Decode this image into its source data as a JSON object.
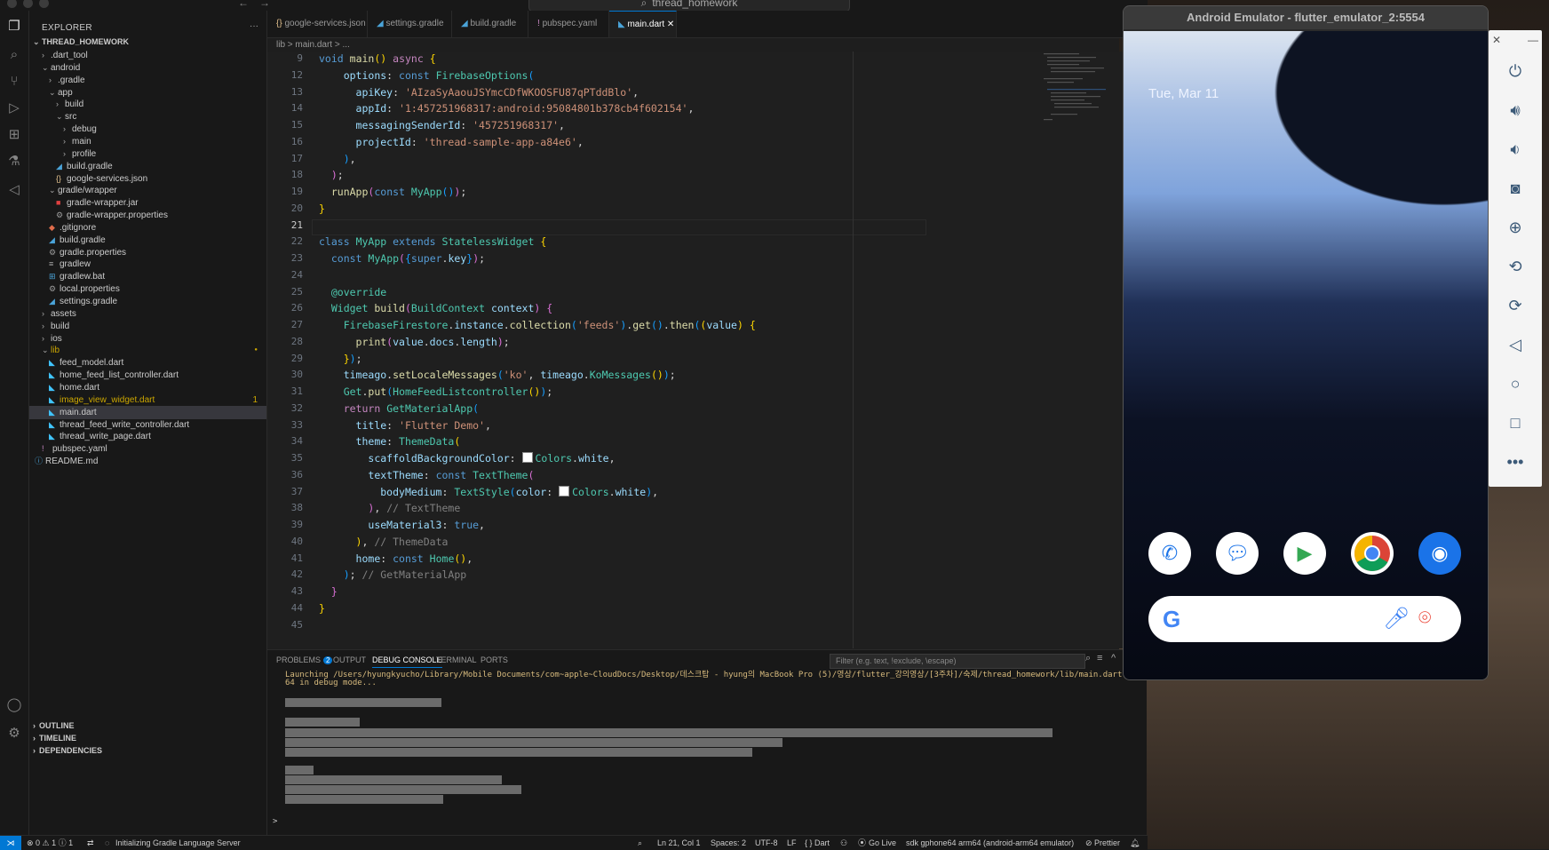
{
  "window": {
    "search_title": "thread_homework"
  },
  "explorer": {
    "title": "EXPLORER",
    "more": "···",
    "root": "THREAD_HOMEWORK",
    "items": [
      {
        "label": ".dart_tool",
        "depth": 1,
        "type": "folder",
        "open": false
      },
      {
        "label": "android",
        "depth": 1,
        "type": "folder",
        "open": true
      },
      {
        "label": ".gradle",
        "depth": 2,
        "type": "folder",
        "open": false
      },
      {
        "label": "app",
        "depth": 2,
        "type": "folder",
        "open": true
      },
      {
        "label": "build",
        "depth": 3,
        "type": "folder",
        "open": false
      },
      {
        "label": "src",
        "depth": 3,
        "type": "folder",
        "open": true
      },
      {
        "label": "debug",
        "depth": 4,
        "type": "folder",
        "open": false
      },
      {
        "label": "main",
        "depth": 4,
        "type": "folder",
        "open": false
      },
      {
        "label": "profile",
        "depth": 4,
        "type": "folder",
        "open": false
      },
      {
        "label": "build.gradle",
        "depth": 3,
        "type": "gradle"
      },
      {
        "label": "google-services.json",
        "depth": 3,
        "type": "json"
      },
      {
        "label": "gradle/wrapper",
        "depth": 2,
        "type": "folder",
        "open": true
      },
      {
        "label": "gradle-wrapper.jar",
        "depth": 3,
        "type": "jar"
      },
      {
        "label": "gradle-wrapper.properties",
        "depth": 3,
        "type": "gear"
      },
      {
        "label": ".gitignore",
        "depth": 2,
        "type": "git"
      },
      {
        "label": "build.gradle",
        "depth": 2,
        "type": "gradle"
      },
      {
        "label": "gradle.properties",
        "depth": 2,
        "type": "gear"
      },
      {
        "label": "gradlew",
        "depth": 2,
        "type": "text"
      },
      {
        "label": "gradlew.bat",
        "depth": 2,
        "type": "win"
      },
      {
        "label": "local.properties",
        "depth": 2,
        "type": "gear"
      },
      {
        "label": "settings.gradle",
        "depth": 2,
        "type": "gradle"
      },
      {
        "label": "assets",
        "depth": 1,
        "type": "folder",
        "open": false
      },
      {
        "label": "build",
        "depth": 1,
        "type": "folder",
        "open": false
      },
      {
        "label": "ios",
        "depth": 1,
        "type": "folder",
        "open": false
      },
      {
        "label": "lib",
        "depth": 1,
        "type": "folder",
        "open": true,
        "modified": true
      },
      {
        "label": "feed_model.dart",
        "depth": 2,
        "type": "dart"
      },
      {
        "label": "home_feed_list_controller.dart",
        "depth": 2,
        "type": "dart"
      },
      {
        "label": "home.dart",
        "depth": 2,
        "type": "dart"
      },
      {
        "label": "image_view_widget.dart",
        "depth": 2,
        "type": "dart",
        "warn": "1"
      },
      {
        "label": "main.dart",
        "depth": 2,
        "type": "dart",
        "selected": true
      },
      {
        "label": "thread_feed_write_controller.dart",
        "depth": 2,
        "type": "dart"
      },
      {
        "label": "thread_write_page.dart",
        "depth": 2,
        "type": "dart"
      },
      {
        "label": "pubspec.yaml",
        "depth": 1,
        "type": "yaml",
        "open": false
      },
      {
        "label": "README.md",
        "depth": 0,
        "type": "md"
      }
    ],
    "sections": [
      "OUTLINE",
      "TIMELINE",
      "DEPENDENCIES"
    ]
  },
  "tabs": [
    {
      "label": "google-services.json",
      "icon": "{}"
    },
    {
      "label": "settings.gradle",
      "icon": "◢"
    },
    {
      "label": "build.gradle",
      "icon": "◢"
    },
    {
      "label": "pubspec.yaml",
      "icon": "!"
    },
    {
      "label": "main.dart",
      "icon": "◣",
      "active": true,
      "close": "✕"
    }
  ],
  "breadcrumb": "lib  >  main.dart  >  ...",
  "editor": {
    "current_line": 21,
    "lines": [
      {
        "n": 9,
        "html": "<span class='k'>void</span> <span class='f'>main</span><span class='p'>()</span> <span class='k2'>async</span> <span class='p'>{</span>"
      },
      {
        "n": 12,
        "html": "    <span class='v'>options</span>: <span class='k'>const</span> <span class='t'>FirebaseOptions</span><span class='p3'>(</span>"
      },
      {
        "n": 13,
        "html": "      <span class='v'>apiKey</span>: <span class='s'>'AIzaSyAaouJSYmcCDfWKOOSFU87qPTddBlo'</span>,"
      },
      {
        "n": 14,
        "html": "      <span class='v'>appId</span>: <span class='s'>'1:457251968317:android:95084801b378cb4f602154'</span>,"
      },
      {
        "n": 15,
        "html": "      <span class='v'>messagingSenderId</span>: <span class='s'>'457251968317'</span>,"
      },
      {
        "n": 16,
        "html": "      <span class='v'>projectId</span>: <span class='s'>'thread-sample-app-a84e6'</span>,"
      },
      {
        "n": 17,
        "html": "    <span class='p3'>)</span>,"
      },
      {
        "n": 18,
        "html": "  <span class='p2'>)</span>;"
      },
      {
        "n": 19,
        "html": "  <span class='f'>runApp</span><span class='p2'>(</span><span class='k'>const</span> <span class='t'>MyApp</span><span class='p3'>()</span><span class='p2'>)</span>;"
      },
      {
        "n": 20,
        "html": "<span class='p'>}</span>"
      },
      {
        "n": 21,
        "html": ""
      },
      {
        "n": 22,
        "html": "<span class='k'>class</span> <span class='t'>MyApp</span> <span class='k'>extends</span> <span class='t'>StatelessWidget</span> <span class='p'>{</span>"
      },
      {
        "n": 23,
        "html": "  <span class='k'>const</span> <span class='t'>MyApp</span><span class='p2'>(</span><span class='p3'>{</span><span class='k'>super</span>.<span class='v'>key</span><span class='p3'>}</span><span class='p2'>)</span>;"
      },
      {
        "n": 24,
        "html": ""
      },
      {
        "n": 25,
        "html": "  <span class='t'>@override</span>"
      },
      {
        "n": 26,
        "html": "  <span class='t'>Widget</span> <span class='f'>build</span><span class='p2'>(</span><span class='t'>BuildContext</span> <span class='v'>context</span><span class='p2'>)</span> <span class='p2'>{</span>"
      },
      {
        "n": 27,
        "html": "    <span class='t'>FirebaseFirestore</span>.<span class='v'>instance</span>.<span class='f'>collection</span><span class='p3'>(</span><span class='s'>'feeds'</span><span class='p3'>)</span>.<span class='f'>get</span><span class='p3'>()</span>.<span class='f'>then</span><span class='p3'>(</span><span class='p'>(</span><span class='v'>value</span><span class='p'>)</span> <span class='p'>{</span>"
      },
      {
        "n": 28,
        "html": "      <span class='f'>print</span><span class='p2'>(</span><span class='v'>value</span>.<span class='v'>docs</span>.<span class='v'>length</span><span class='p2'>)</span>;"
      },
      {
        "n": 29,
        "html": "    <span class='p'>}</span><span class='p3'>)</span>;"
      },
      {
        "n": 30,
        "html": "    <span class='v'>timeago</span>.<span class='f'>setLocaleMessages</span><span class='p3'>(</span><span class='s'>'ko'</span>, <span class='v'>timeago</span>.<span class='t'>KoMessages</span><span class='p'>()</span><span class='p3'>)</span>;"
      },
      {
        "n": 31,
        "html": "    <span class='t'>Get</span>.<span class='f'>put</span><span class='p3'>(</span><span class='t'>HomeFeedListcontroller</span><span class='p'>()</span><span class='p3'>)</span>;"
      },
      {
        "n": 32,
        "html": "    <span class='k2'>return</span> <span class='t'>GetMaterialApp</span><span class='p3'>(</span>"
      },
      {
        "n": 33,
        "html": "      <span class='v'>title</span>: <span class='s'>'Flutter Demo'</span>,"
      },
      {
        "n": 34,
        "html": "      <span class='v'>theme</span>: <span class='t'>ThemeData</span><span class='p'>(</span>"
      },
      {
        "n": 35,
        "html": "        <span class='v'>scaffoldBackgroundColor</span>: <span class='sw'></span><span class='t'>Colors</span>.<span class='v'>white</span>,"
      },
      {
        "n": 36,
        "html": "        <span class='v'>textTheme</span>: <span class='k'>const</span> <span class='t'>TextTheme</span><span class='p2'>(</span>"
      },
      {
        "n": 37,
        "html": "          <span class='v'>bodyMedium</span>: <span class='t'>TextStyle</span><span class='p3'>(</span><span class='v'>color</span>: <span class='sw'></span><span class='t'>Colors</span>.<span class='v'>white</span><span class='p3'>)</span>,"
      },
      {
        "n": 38,
        "html": "        <span class='p2'>)</span>, <span class='g'>// TextTheme</span>"
      },
      {
        "n": 39,
        "html": "        <span class='v'>useMaterial3</span>: <span class='k'>true</span>,"
      },
      {
        "n": 40,
        "html": "      <span class='p'>)</span>, <span class='g'>// ThemeData</span>"
      },
      {
        "n": 41,
        "html": "      <span class='v'>home</span>: <span class='k'>const</span> <span class='t'>Home</span><span class='p'>()</span>,"
      },
      {
        "n": 42,
        "html": "    <span class='p3'>)</span>; <span class='g'>// GetMaterialApp</span>"
      },
      {
        "n": 43,
        "html": "  <span class='p2'>}</span>"
      },
      {
        "n": 44,
        "html": "<span class='p'>}</span>"
      },
      {
        "n": 45,
        "html": ""
      }
    ]
  },
  "panel": {
    "tabs": [
      {
        "label": "PROBLEMS",
        "badge": "2"
      },
      {
        "label": "OUTPUT"
      },
      {
        "label": "DEBUG CONSOLE",
        "active": true
      },
      {
        "label": "TERMINAL"
      },
      {
        "label": "PORTS"
      }
    ],
    "filter_placeholder": "Filter (e.g. text, !exclude, \\escape)",
    "launch_line1": "Launching /Users/hyungkyucho/Library/Mobile Documents/com~apple~CloudDocs/Desktop/데스크탑 - hyung의 MacBook Pro (5)/영상/flutter_강의영상/[3주차]/숙제/thread_homework/lib/main.dart on sdk gphone64",
    "launch_line2": "64 in debug mode...",
    "prompt": ">"
  },
  "statusbar": {
    "remote": "⋊",
    "problems": "⊗ 0  ⚠ 1  ⓘ 1",
    "task": "Initializing Gradle Language Server",
    "position": "Ln 21, Col 1",
    "spaces": "Spaces: 2",
    "encoding": "UTF-8",
    "eol": "LF",
    "language": "{ }  Dart",
    "golive": "Go Live",
    "device": "sdk gphone64 arm64 (android-arm64 emulator)",
    "prettier": "Prettier"
  },
  "emulator": {
    "title": "Android Emulator - flutter_emulator_2:5554",
    "date": "Tue, Mar 11",
    "dock_apps": [
      "phone-icon",
      "messages-icon",
      "play-store-icon",
      "chrome-icon",
      "camera-icon"
    ],
    "google_logo": "G"
  },
  "colors": {
    "accent": "#0078d4",
    "error": "#f14c4c",
    "editor_bg": "#1f1f1f"
  }
}
